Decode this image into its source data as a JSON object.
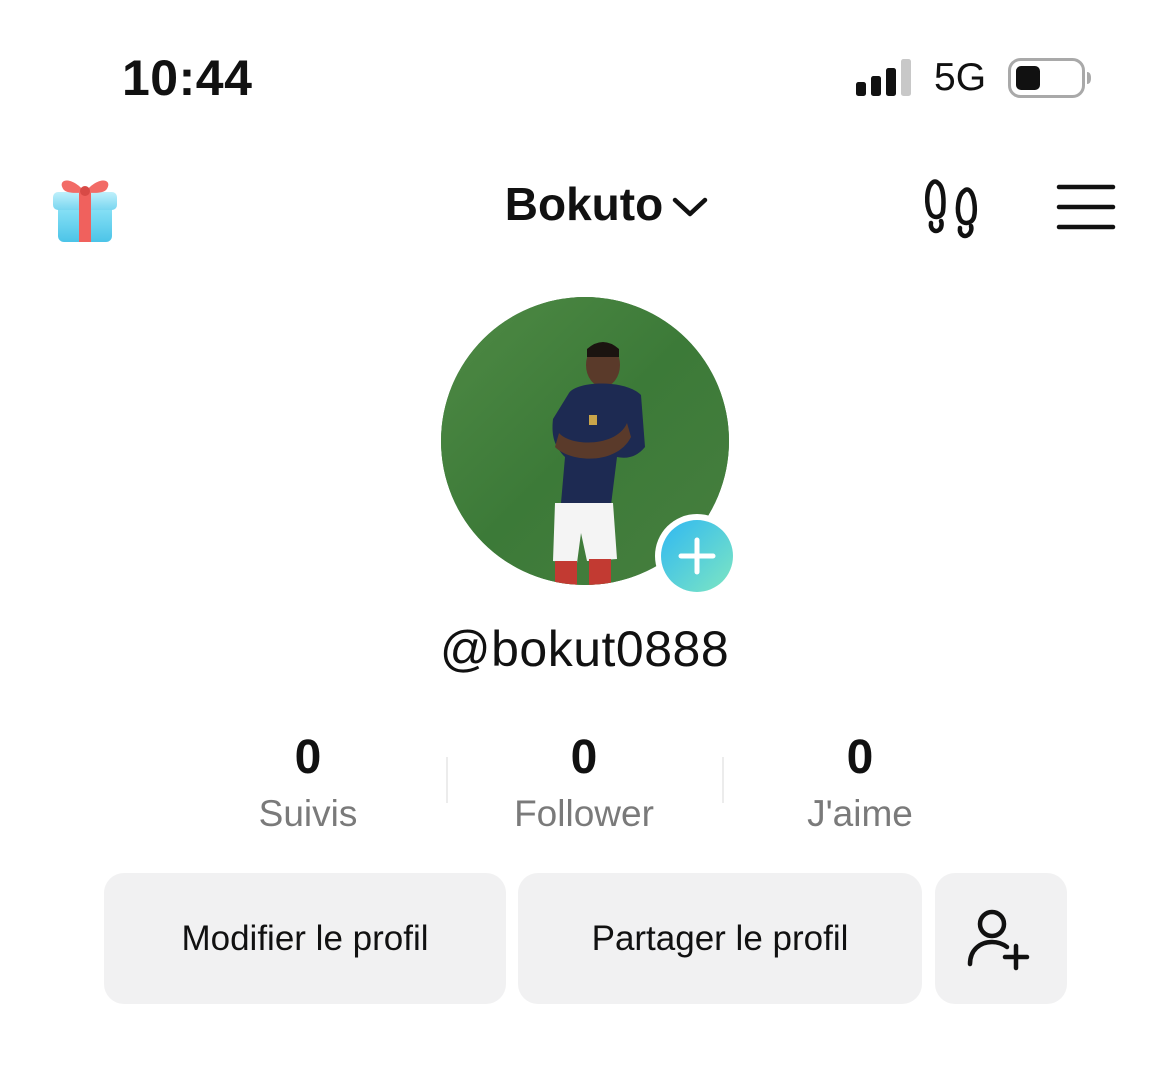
{
  "status_bar": {
    "time": "10:44",
    "network": "5G",
    "signal_bars": 3,
    "battery_level": 0.35
  },
  "header": {
    "title": "Bokuto",
    "left_icon": "gift-icon",
    "right_icons": [
      "footprints-icon",
      "menu-icon"
    ]
  },
  "profile": {
    "username": "@bokut0888",
    "avatar_description": "profile-photo"
  },
  "stats": [
    {
      "value": "0",
      "label": "Suivis"
    },
    {
      "value": "0",
      "label": "Follower"
    },
    {
      "value": "0",
      "label": "J'aime"
    }
  ],
  "actions": {
    "edit_label": "Modifier le profil",
    "share_label": "Partager le profil",
    "add_friend_icon": "add-user-icon"
  },
  "colors": {
    "button_bg": "#f1f1f2",
    "secondary_text": "#7a7a7a",
    "accent_gradient_start": "#28c0f0",
    "accent_gradient_end": "#79e4c4"
  }
}
